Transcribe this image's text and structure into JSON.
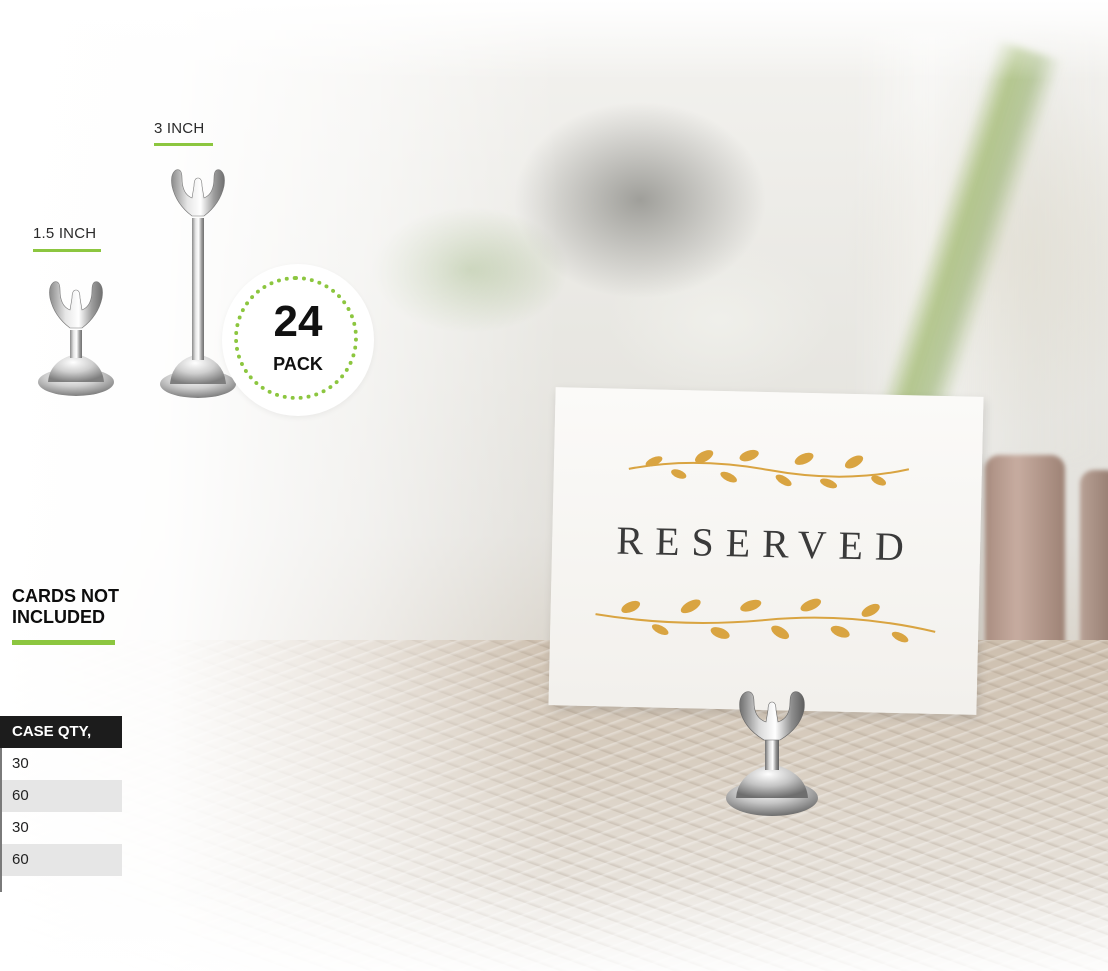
{
  "labels": {
    "size_small": "1.5 INCH",
    "size_large": "3 INCH"
  },
  "badge": {
    "count": "24",
    "unit": "PACK"
  },
  "notice": {
    "line1": "CARDS NOT",
    "line2": "INCLUDED"
  },
  "table": {
    "header": "CASE QTY,",
    "rows": [
      "30",
      "60",
      "30",
      "60"
    ]
  },
  "card": {
    "text": "RESERVED"
  },
  "colors": {
    "accent_green": "#8cc63f",
    "header_dark": "#1c1c1c",
    "vine_gold": "#d9a441"
  },
  "icons": {
    "holder_small": "chrome-place-card-holder-icon",
    "holder_large": "chrome-place-card-holder-tall-icon"
  }
}
